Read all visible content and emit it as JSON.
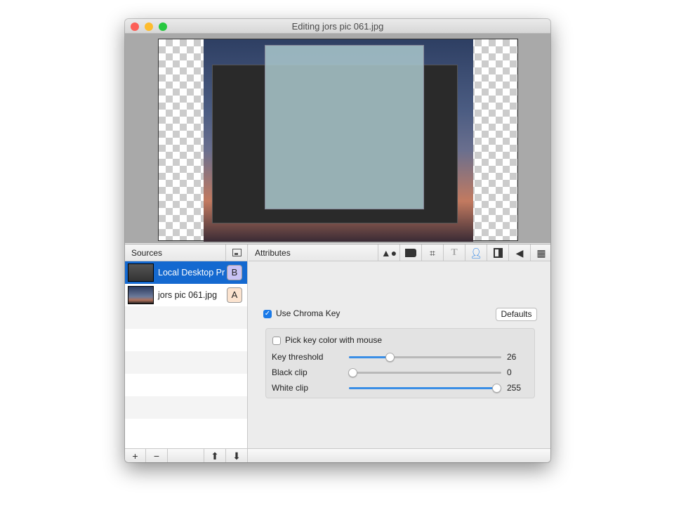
{
  "window": {
    "title": "Editing jors pic 061.jpg"
  },
  "sources": {
    "header": "Sources",
    "items": [
      {
        "name": "Local Desktop Pr",
        "badge": "B",
        "selected": true,
        "badge_color": "#c9c3f5"
      },
      {
        "name": "jors pic 061.jpg",
        "badge": "A",
        "selected": false,
        "badge_color": "#fbe3cf"
      }
    ],
    "footer": {
      "add": "+",
      "remove": "−",
      "up": "⬆",
      "down": "⬇"
    }
  },
  "attributes": {
    "header": "Attributes",
    "tools": [
      "shapes-icon",
      "folder-icon",
      "crop-icon",
      "text-icon",
      "chroma-key-person-icon",
      "mask-icon",
      "audio-speaker-icon",
      "film-icon"
    ],
    "active_tool": "chroma-key-person-icon",
    "use_chroma_key": {
      "label": "Use Chroma Key",
      "checked": true
    },
    "defaults_label": "Defaults",
    "pick_key": {
      "label": "Pick key color with mouse",
      "checked": false
    },
    "sliders": [
      {
        "label": "Key threshold",
        "value": 26,
        "max": 255
      },
      {
        "label": "Black clip",
        "value": 0,
        "max": 255
      },
      {
        "label": "White clip",
        "value": 255,
        "max": 255
      }
    ]
  },
  "colors": {
    "accent": "#1469d0",
    "slider_fill": "#3a8ee6"
  }
}
